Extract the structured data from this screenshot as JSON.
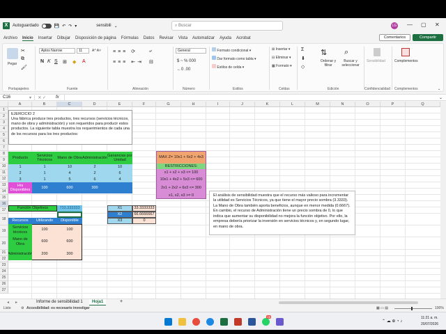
{
  "titlebar": {
    "autosave": "Autoguardado",
    "filename": "sensibili",
    "search_placeholder": "Buscar",
    "avatar": "LG"
  },
  "menu": [
    "Archivo",
    "Inicio",
    "Insertar",
    "Dibujar",
    "Disposición de página",
    "Fórmulas",
    "Datos",
    "Revisar",
    "Vista",
    "Automatizar",
    "Ayuda",
    "Acrobat"
  ],
  "menu_buttons": {
    "comments": "Comentarios",
    "share": "Compartir"
  },
  "ribbon": {
    "paste": "Pegar",
    "font": "Aptos Narrow",
    "font_size": "11",
    "number_format": "General",
    "cond_format": "Formato condicional",
    "table_format": "Dar formato como tabla",
    "cell_styles": "Estilos de celda",
    "insert": "Insertar",
    "delete": "Eliminar",
    "format": "Formato",
    "sort": "Ordenar y filtrar",
    "find": "Buscar y seleccionar",
    "sensitivity": "Sensibilidad",
    "addins": "Complementos",
    "groups": [
      "Portapapeles",
      "Fuente",
      "Alineación",
      "Número",
      "Estilos",
      "Celdas",
      "Edición",
      "Confidencialidad",
      "Complementos"
    ]
  },
  "formula_bar": {
    "cell_ref": "C16",
    "fx": "fx"
  },
  "columns": [
    "A",
    "B",
    "C",
    "D",
    "E",
    "F",
    "G",
    "H",
    "I",
    "J",
    "K",
    "L",
    "M",
    "N",
    "O",
    "P",
    "Q"
  ],
  "rows": [
    "1",
    "2",
    "3",
    "4",
    "5",
    "6",
    "7",
    "8",
    "9",
    "10",
    "11",
    "12",
    "13",
    "14",
    "15",
    "16",
    "17",
    "18",
    "19",
    "20",
    "21",
    "22",
    "23",
    "24",
    "25",
    "26",
    "27"
  ],
  "exercise": {
    "title": "EJERCICIO 2",
    "body": "Una fábrica produce tres productos, tres recursos (servicios técnicos, mano de obra y administración) y son requeridos para producir estos productos. La siguiente tabla muestra los requerimientos de cada una de los recursos para los tres productos:"
  },
  "table": {
    "headers": [
      "Producto",
      "Servicios Técnicos",
      "Mano de Obra",
      "Administración",
      "Ganancias por Unidad"
    ],
    "rows": [
      [
        "1",
        "1",
        "10",
        "2",
        "10"
      ],
      [
        "2",
        "1",
        "4",
        "2",
        "6"
      ],
      [
        "3",
        "1",
        "5",
        "6",
        "4"
      ]
    ],
    "available_label": "Hrs Disponibles",
    "available": [
      "100",
      "600",
      "300"
    ]
  },
  "model": {
    "objective": "MAX Z= 10x1 + 6x2 + 4x3",
    "restrictions_label": "RESTRICCIONES:",
    "r1": "x1 + x2 + x3 <= 100",
    "r2": "10x1 + 4x2 + 5x3 <= 600",
    "r3": "2x1 + 2x2 + 6x3 <= 300",
    "r4": "x1, x2, x3 >= 0"
  },
  "objective_row": {
    "label": "Función Objetivos",
    "value": "733.333333"
  },
  "resources": {
    "headers": [
      "Recursos",
      "Utilizando",
      "Disponible"
    ],
    "rows": [
      [
        "Servicios técnicos",
        "100",
        "100"
      ],
      [
        "Mano de Obra",
        "600",
        "600"
      ],
      [
        "Administración",
        "200",
        "300"
      ]
    ]
  },
  "variables": [
    {
      "name": "X1",
      "value": "33.3333333"
    },
    {
      "name": "X2",
      "value": "66.6666667"
    },
    {
      "name": "X3",
      "value": "0"
    }
  ],
  "analysis": "El análisis de sensibilidad muestra que el recurso más valioso para incrementar la utilidad es Servicios Técnicos, ya que tiene el mayor precio sombra (3.3333). La Mano de Obra también aporta beneficios, aunque en menor medida (0.6667). En cambio, el recurso de Administración tiene un precio sombra de 0, lo que indica que aumentar su disponibilidad no mejora la función objetivo. Por ello, la empresa debería priorizar la inversión en servicios técnicos y, en segundo lugar, en mano de obra.",
  "sheets": [
    "Informe de sensibilidad 1",
    "Hoja1"
  ],
  "status": {
    "ready": "Listo",
    "accessibility": "Accesibilidad: es necesario investigar",
    "zoom": "100%"
  },
  "taskbar": {
    "time": "11:21 a. m.",
    "date": "20/07/2026",
    "badge": "15"
  }
}
